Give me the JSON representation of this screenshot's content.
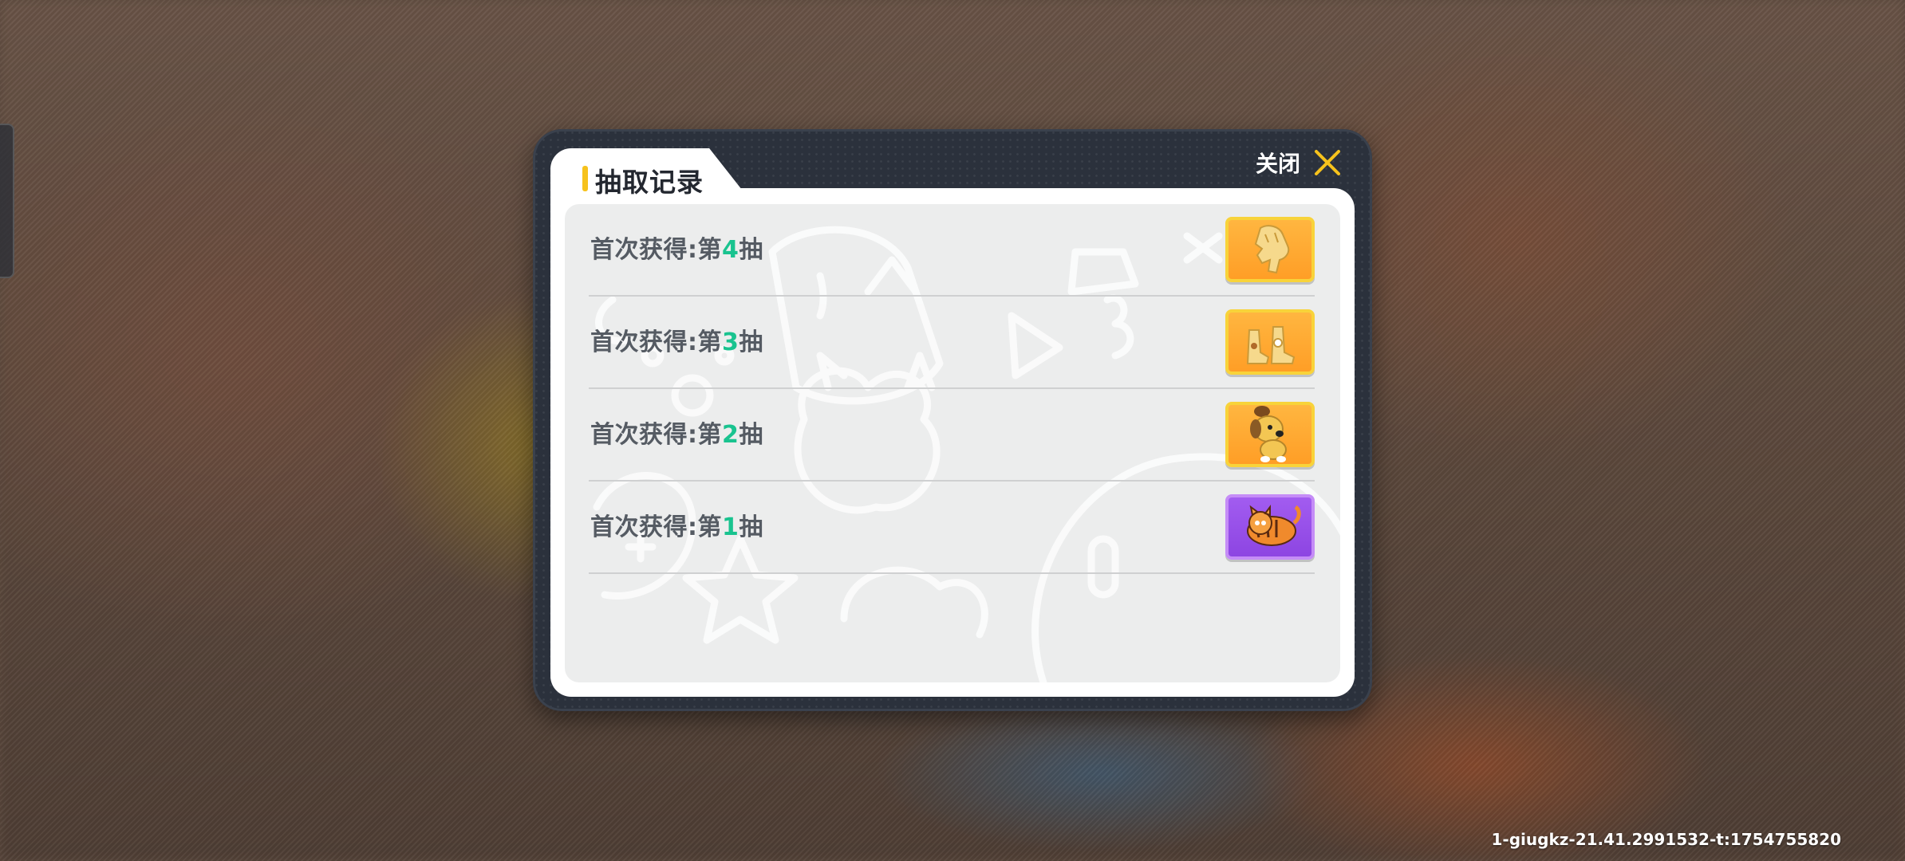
{
  "dialog": {
    "title": "抽取记录",
    "close_label": "关闭"
  },
  "records": [
    {
      "prefix": "首次获得:第",
      "number": "4",
      "suffix": "抽",
      "item_icon": "golden-hand-glove",
      "rarity_color": "#ffa530"
    },
    {
      "prefix": "首次获得:第",
      "number": "3",
      "suffix": "抽",
      "item_icon": "golden-boots-pair",
      "rarity_color": "#ffa530"
    },
    {
      "prefix": "首次获得:第",
      "number": "2",
      "suffix": "抽",
      "item_icon": "dog-figure",
      "rarity_color": "#ffa530"
    },
    {
      "prefix": "首次获得:第",
      "number": "1",
      "suffix": "抽",
      "item_icon": "orange-tabby-cat",
      "rarity_color": "#9650ea"
    }
  ],
  "footer": {
    "build_id": "1-giugkz-21.41.2991532-t:1754755820"
  },
  "colors": {
    "accent_yellow": "#f6c21c",
    "number_green": "#19c38f",
    "panel_dark": "#2b313c"
  }
}
